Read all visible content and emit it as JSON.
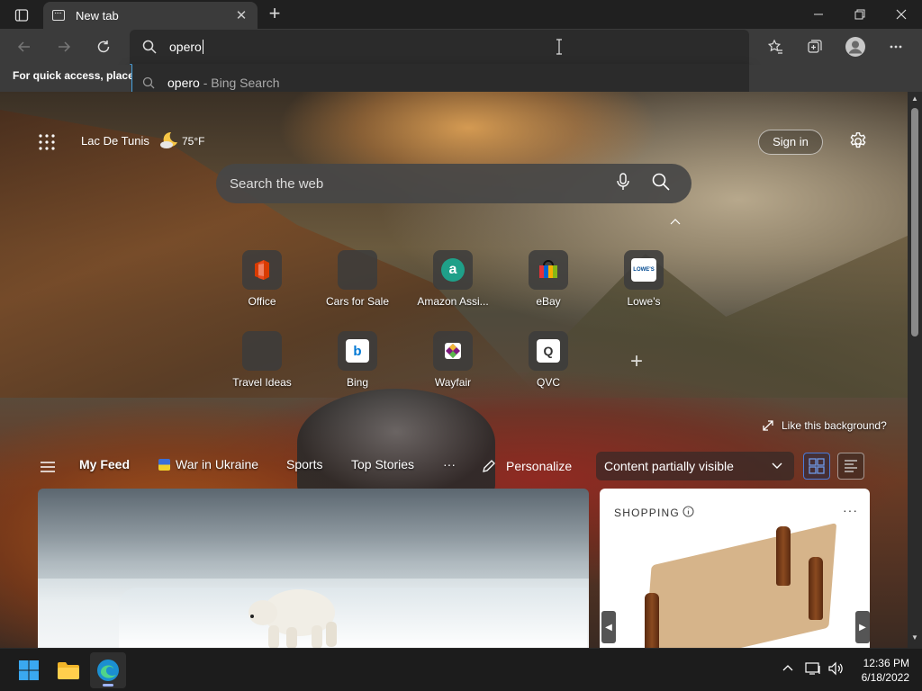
{
  "tab": {
    "title": "New tab"
  },
  "address": {
    "typed": "opero"
  },
  "suggestion": {
    "query": "opero",
    "separator": " - ",
    "source": "Bing Search"
  },
  "favbar": {
    "hint": "For quick access, place y"
  },
  "header": {
    "location": "Lac De Tunis",
    "temperature": "75°F",
    "signin": "Sign in"
  },
  "search": {
    "placeholder": "Search the web"
  },
  "tiles": [
    {
      "label": "Office",
      "icon": "office-icon"
    },
    {
      "label": "Cars for Sale",
      "icon": "cars-icon"
    },
    {
      "label": "Amazon Assi...",
      "icon": "amazon-icon",
      "glyph": "a"
    },
    {
      "label": "eBay",
      "icon": "ebay-icon"
    },
    {
      "label": "Lowe's",
      "icon": "lowes-icon",
      "glyph": "LOWE'S"
    },
    {
      "label": "Travel Ideas",
      "icon": "travel-icon"
    },
    {
      "label": "Bing",
      "icon": "bing-icon",
      "glyph": "b"
    },
    {
      "label": "Wayfair",
      "icon": "wayfair-icon"
    },
    {
      "label": "QVC",
      "icon": "qvc-icon",
      "glyph": "Q"
    }
  ],
  "add_tile": "+",
  "background": {
    "like": "Like this background?"
  },
  "feed": {
    "my_feed": "My Feed",
    "ukraine": "War in Ukraine",
    "sports": "Sports",
    "top_stories": "Top Stories",
    "more": "···",
    "personalize": "Personalize",
    "visibility": "Content partially visible"
  },
  "shopping": {
    "title": "SHOPPING",
    "more": "···"
  },
  "clock": {
    "time": "12:36 PM",
    "date": "6/18/2022"
  },
  "colors": {
    "accent": "#4aa3df",
    "tab_bg": "#3b3b3b",
    "toolbar_bg": "#3b3b3b",
    "taskbar_bg": "#1c1c1c"
  }
}
